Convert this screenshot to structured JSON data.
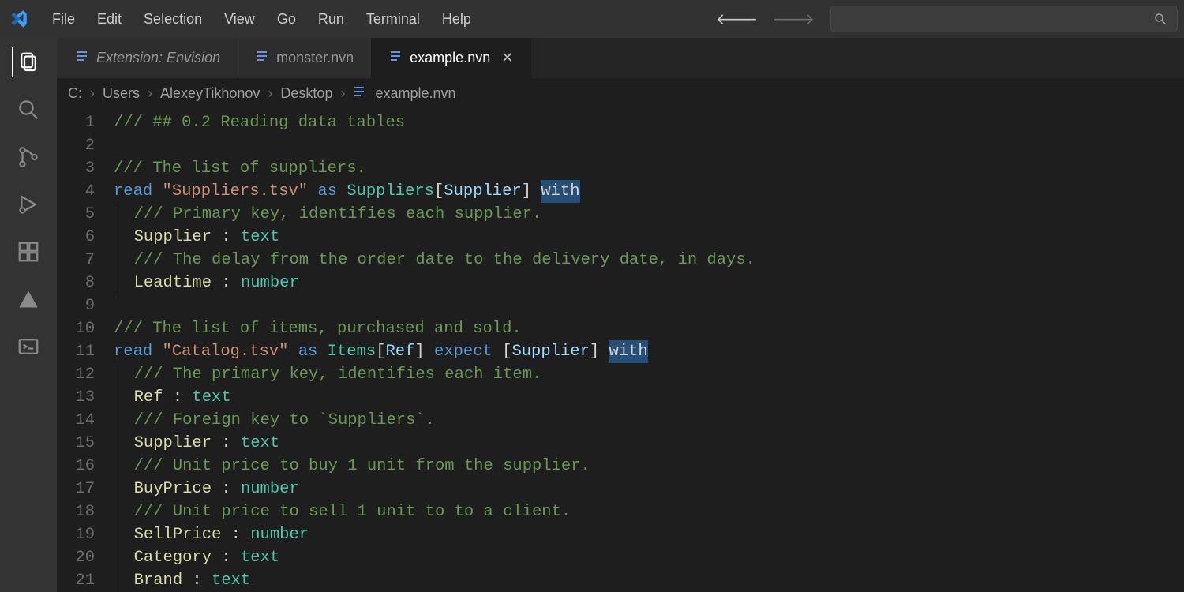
{
  "menu": {
    "items": [
      "File",
      "Edit",
      "Selection",
      "View",
      "Go",
      "Run",
      "Terminal",
      "Help"
    ]
  },
  "tabs": [
    {
      "label": "Extension: Envision",
      "active": false,
      "italic": true,
      "closable": false
    },
    {
      "label": "monster.nvn",
      "active": false,
      "italic": false,
      "closable": false
    },
    {
      "label": "example.nvn",
      "active": true,
      "italic": false,
      "closable": true
    }
  ],
  "breadcrumb": {
    "parts": [
      "C:",
      "Users",
      "AlexeyTikhonov",
      "Desktop"
    ],
    "file": "example.nvn"
  },
  "activity": [
    "explorer-icon",
    "search-icon",
    "source-control-icon",
    "run-debug-icon",
    "extensions-icon",
    "triangle-icon",
    "terminal-icon"
  ],
  "code": {
    "lines": [
      {
        "n": 1,
        "indent": 0,
        "tokens": [
          {
            "t": "comment",
            "v": "/// ## 0.2 Reading data tables"
          }
        ]
      },
      {
        "n": 2,
        "indent": 0,
        "tokens": []
      },
      {
        "n": 3,
        "indent": 0,
        "tokens": [
          {
            "t": "comment",
            "v": "/// The list of suppliers."
          }
        ]
      },
      {
        "n": 4,
        "indent": 0,
        "tokens": [
          {
            "t": "keyword",
            "v": "read "
          },
          {
            "t": "string",
            "v": "\"Suppliers.tsv\""
          },
          {
            "t": "keyword",
            "v": " as "
          },
          {
            "t": "type",
            "v": "Suppliers"
          },
          {
            "t": "punct",
            "v": "["
          },
          {
            "t": "ref",
            "v": "Supplier"
          },
          {
            "t": "punct",
            "v": "] "
          },
          {
            "t": "keyword",
            "v": "with",
            "sel": true
          }
        ]
      },
      {
        "n": 5,
        "indent": 1,
        "tokens": [
          {
            "t": "comment",
            "v": "/// Primary key, identifies each supplier."
          }
        ]
      },
      {
        "n": 6,
        "indent": 1,
        "tokens": [
          {
            "t": "field",
            "v": "Supplier"
          },
          {
            "t": "punct",
            "v": " : "
          },
          {
            "t": "type",
            "v": "text"
          }
        ]
      },
      {
        "n": 7,
        "indent": 1,
        "tokens": [
          {
            "t": "comment",
            "v": "/// The delay from the order date to the delivery date, in days."
          }
        ]
      },
      {
        "n": 8,
        "indent": 1,
        "tokens": [
          {
            "t": "field",
            "v": "Leadtime"
          },
          {
            "t": "punct",
            "v": " : "
          },
          {
            "t": "type",
            "v": "number"
          }
        ]
      },
      {
        "n": 9,
        "indent": 0,
        "tokens": []
      },
      {
        "n": 10,
        "indent": 0,
        "tokens": [
          {
            "t": "comment",
            "v": "/// The list of items, purchased and sold."
          }
        ]
      },
      {
        "n": 11,
        "indent": 0,
        "tokens": [
          {
            "t": "keyword",
            "v": "read "
          },
          {
            "t": "string",
            "v": "\"Catalog.tsv\""
          },
          {
            "t": "keyword",
            "v": " as "
          },
          {
            "t": "type",
            "v": "Items"
          },
          {
            "t": "punct",
            "v": "["
          },
          {
            "t": "ref",
            "v": "Ref"
          },
          {
            "t": "punct",
            "v": "] "
          },
          {
            "t": "keyword",
            "v": "expect "
          },
          {
            "t": "punct",
            "v": "["
          },
          {
            "t": "ref",
            "v": "Supplier"
          },
          {
            "t": "punct",
            "v": "] "
          },
          {
            "t": "keyword",
            "v": "with",
            "sel": true
          }
        ]
      },
      {
        "n": 12,
        "indent": 1,
        "tokens": [
          {
            "t": "comment",
            "v": "/// The primary key, identifies each item."
          }
        ]
      },
      {
        "n": 13,
        "indent": 1,
        "tokens": [
          {
            "t": "field",
            "v": "Ref"
          },
          {
            "t": "punct",
            "v": " : "
          },
          {
            "t": "type",
            "v": "text"
          }
        ]
      },
      {
        "n": 14,
        "indent": 1,
        "tokens": [
          {
            "t": "comment",
            "v": "/// Foreign key to `Suppliers`."
          }
        ]
      },
      {
        "n": 15,
        "indent": 1,
        "tokens": [
          {
            "t": "field",
            "v": "Supplier"
          },
          {
            "t": "punct",
            "v": " : "
          },
          {
            "t": "type",
            "v": "text"
          }
        ]
      },
      {
        "n": 16,
        "indent": 1,
        "tokens": [
          {
            "t": "comment",
            "v": "/// Unit price to buy 1 unit from the supplier."
          }
        ]
      },
      {
        "n": 17,
        "indent": 1,
        "tokens": [
          {
            "t": "field",
            "v": "BuyPrice"
          },
          {
            "t": "punct",
            "v": " : "
          },
          {
            "t": "type",
            "v": "number"
          }
        ]
      },
      {
        "n": 18,
        "indent": 1,
        "tokens": [
          {
            "t": "comment",
            "v": "/// Unit price to sell 1 unit to to a client."
          }
        ]
      },
      {
        "n": 19,
        "indent": 1,
        "tokens": [
          {
            "t": "field",
            "v": "SellPrice"
          },
          {
            "t": "punct",
            "v": " : "
          },
          {
            "t": "type",
            "v": "number"
          }
        ]
      },
      {
        "n": 20,
        "indent": 1,
        "tokens": [
          {
            "t": "field",
            "v": "Category"
          },
          {
            "t": "punct",
            "v": " : "
          },
          {
            "t": "type",
            "v": "text"
          }
        ]
      },
      {
        "n": 21,
        "indent": 1,
        "tokens": [
          {
            "t": "field",
            "v": "Brand"
          },
          {
            "t": "punct",
            "v": " : "
          },
          {
            "t": "type",
            "v": "text"
          }
        ]
      }
    ]
  }
}
